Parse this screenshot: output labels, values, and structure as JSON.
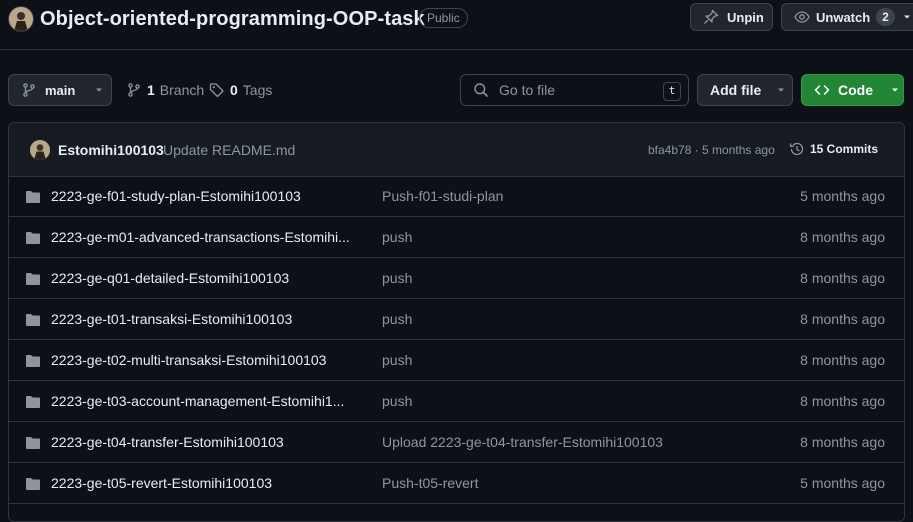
{
  "repo": {
    "title": "Object-oriented-programming-OOP-task",
    "visibility": "Public",
    "unpin_label": "Unpin",
    "unwatch_label": "Unwatch",
    "watch_count": "2"
  },
  "toolbar": {
    "branch": "main",
    "branch_count": "1",
    "branch_label": "Branch",
    "tag_count": "0",
    "tag_label": "Tags",
    "goto_placeholder": "Go to file",
    "goto_shortcut": "t",
    "add_file_label": "Add file",
    "code_label": "Code"
  },
  "latest_commit": {
    "author": "Estomihi100103",
    "message": "Update README.md",
    "meta": "bfa4b78 · 5 months ago",
    "commits_label": "15 Commits"
  },
  "files": [
    {
      "name": "2223-ge-f01-study-plan-Estomihi100103",
      "message": "Push-f01-studi-plan",
      "age": "5 months ago"
    },
    {
      "name": "2223-ge-m01-advanced-transactions-Estomihi...",
      "message": "push",
      "age": "8 months ago"
    },
    {
      "name": "2223-ge-q01-detailed-Estomihi100103",
      "message": "push",
      "age": "8 months ago"
    },
    {
      "name": "2223-ge-t01-transaksi-Estomihi100103",
      "message": "push",
      "age": "8 months ago"
    },
    {
      "name": "2223-ge-t02-multi-transaksi-Estomihi100103",
      "message": "push",
      "age": "8 months ago"
    },
    {
      "name": "2223-ge-t03-account-management-Estomihi1...",
      "message": "push",
      "age": "8 months ago"
    },
    {
      "name": "2223-ge-t04-transfer-Estomihi100103",
      "message": "Upload 2223-ge-t04-transfer-Estomihi100103",
      "age": "8 months ago"
    },
    {
      "name": "2223-ge-t05-revert-Estomihi100103",
      "message": "Push-t05-revert",
      "age": "5 months ago"
    }
  ],
  "icons": {
    "pin": "pin-icon",
    "eye": "eye-icon",
    "branch": "git-branch-icon",
    "tag": "tag-icon",
    "search": "search-icon",
    "code": "code-icon",
    "history": "history-icon",
    "folder": "folder-icon"
  },
  "colors": {
    "background": "#0d1117",
    "code_button": "#238636",
    "folder": "#8d96a0",
    "border": "#30363d"
  }
}
